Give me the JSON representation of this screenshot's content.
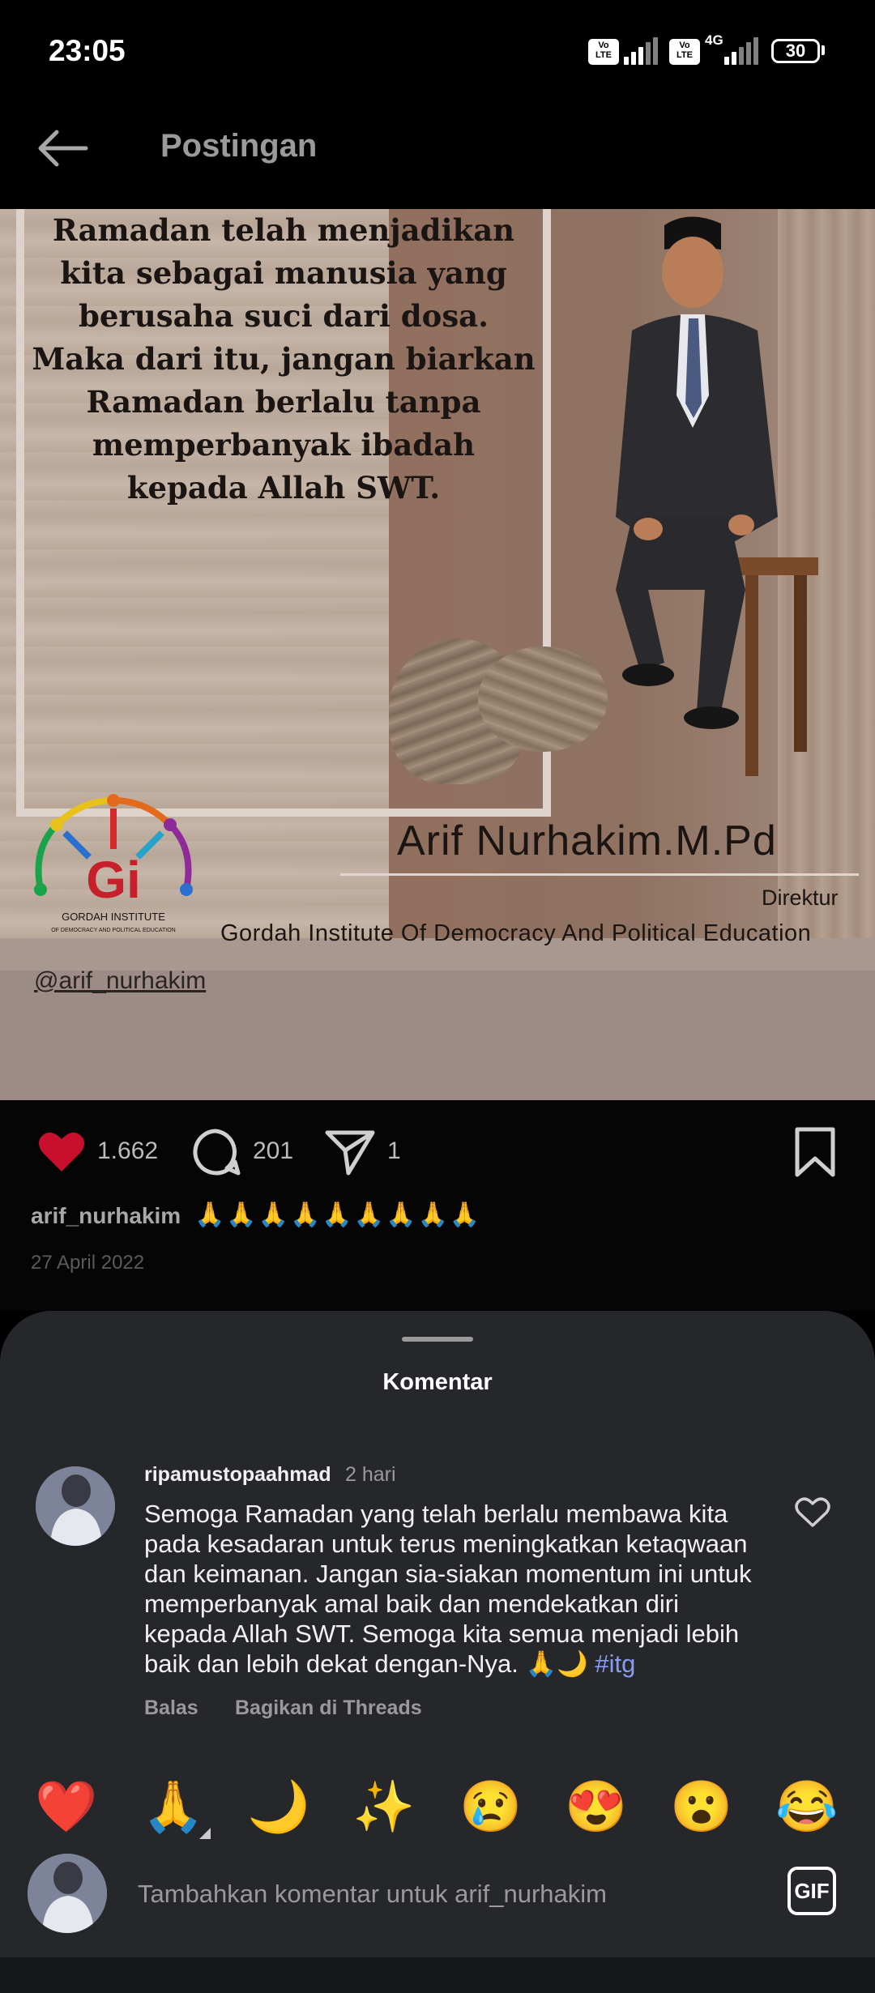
{
  "status_bar": {
    "time": "23:05",
    "volte_1": "Vo LTE",
    "volte_2": "Vo LTE",
    "network": "4G",
    "battery": "30"
  },
  "header": {
    "back_icon": "back-arrow-icon",
    "title": "Postingan"
  },
  "post": {
    "quote_lines": [
      "Ramadan telah menjadikan",
      "kita sebagai manusia yang",
      "berusaha suci dari dosa.",
      "Maka dari itu, jangan biarkan",
      "Ramadan berlalu tanpa",
      "memperbanyak ibadah",
      "kepada Allah SWT."
    ],
    "person_name": "Arif Nurhakim.M.Pd",
    "person_role": "Direktur",
    "organization": "Gordah Institute Of Democracy And Political Education",
    "logo_text": "GORDAH INSTITUTE",
    "logo_subtext": "OF DEMOCRACY AND POLITICAL EDUCATION",
    "image_handle": "@arif_nurhakim",
    "likes": "1.662",
    "comments": "201",
    "shares": "1",
    "caption_user": "arif_nurhakim",
    "caption_emoji": "🙏🙏🙏🙏🙏🙏🙏🙏🙏",
    "date": "27 April 2022"
  },
  "comments_sheet": {
    "title": "Komentar",
    "comment": {
      "username": "ripamustopaahmad",
      "time": "2 hari",
      "text": "Semoga Ramadan yang telah berlalu membawa kita pada kesadaran untuk terus meningkatkan ketaqwaan dan keimanan. Jangan sia-siakan momentum ini untuk memperbanyak amal baik dan mendekatkan diri kepada Allah SWT. Semoga kita semua menjadi lebih baik dan lebih dekat dengan-Nya. 🙏🌙",
      "hashtag": "#itg",
      "reply_label": "Balas",
      "share_label": "Bagikan di Threads"
    },
    "emoji_bar": [
      "❤️",
      "🙏",
      "🌙",
      "✨",
      "😢",
      "😍",
      "😮",
      "😂"
    ],
    "input_placeholder": "Tambahkan komentar untuk arif_nurhakim",
    "gif_label": "GIF"
  },
  "colors": {
    "like_red": "#c8102e",
    "hashtag": "#8a9cf2",
    "sheet_bg": "#25272b"
  }
}
